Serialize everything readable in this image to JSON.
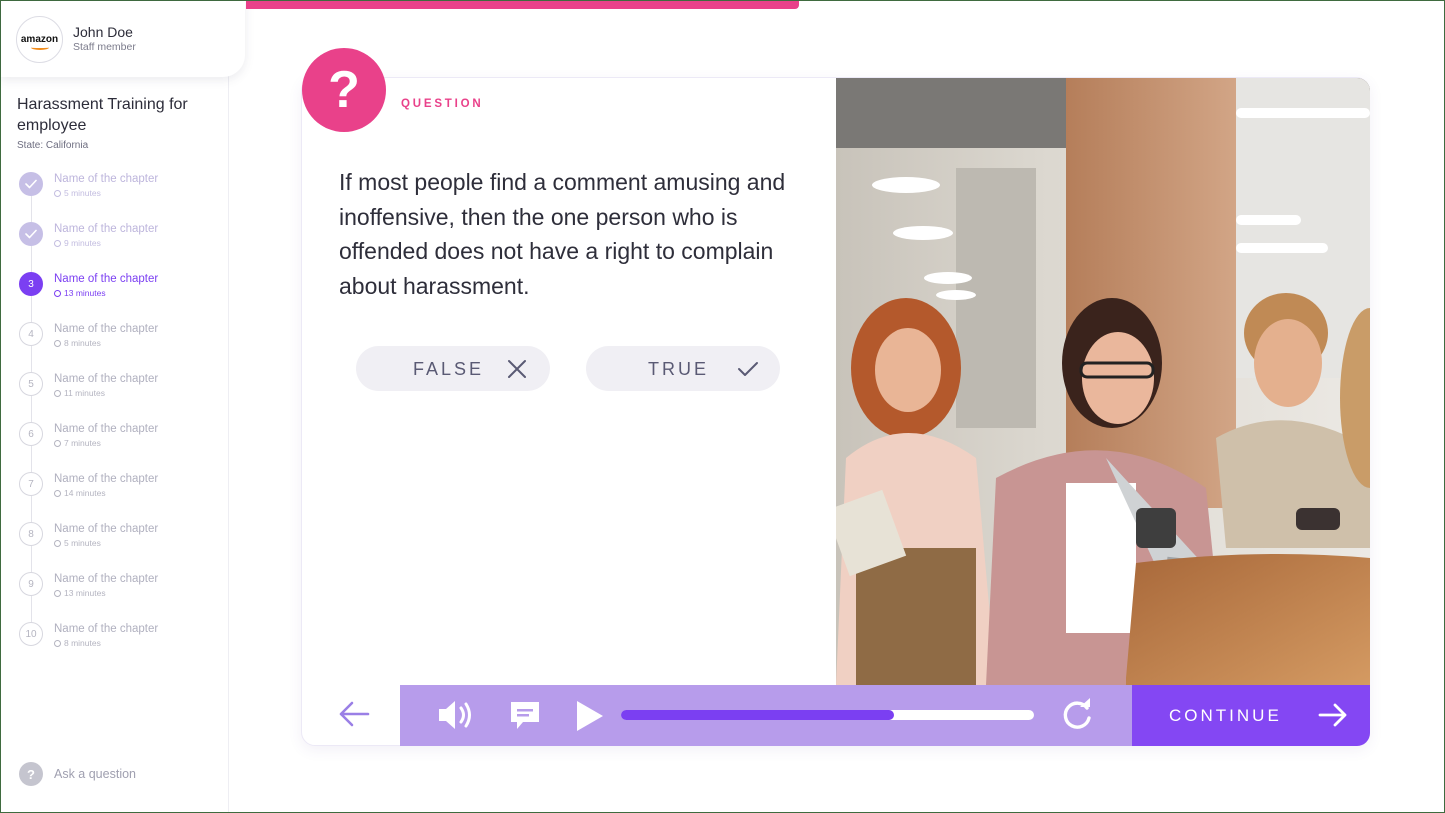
{
  "user": {
    "company_logo": "amazon",
    "name": "John Doe",
    "role": "Staff member"
  },
  "course": {
    "title": "Harassment Training for employee",
    "state": "State: California"
  },
  "chapters": [
    {
      "number": "1",
      "name": "Name of the chapter",
      "duration": "5 minutes",
      "status": "done"
    },
    {
      "number": "2",
      "name": "Name of the chapter",
      "duration": "9 minutes",
      "status": "done"
    },
    {
      "number": "3",
      "name": "Name of the chapter",
      "duration": "13 minutes",
      "status": "active"
    },
    {
      "number": "4",
      "name": "Name of the chapter",
      "duration": "8 minutes",
      "status": "upcoming"
    },
    {
      "number": "5",
      "name": "Name of the chapter",
      "duration": "11 minutes",
      "status": "upcoming"
    },
    {
      "number": "6",
      "name": "Name of the chapter",
      "duration": "7 minutes",
      "status": "upcoming"
    },
    {
      "number": "7",
      "name": "Name of the chapter",
      "duration": "14 minutes",
      "status": "upcoming"
    },
    {
      "number": "8",
      "name": "Name of the chapter",
      "duration": "5 minutes",
      "status": "upcoming"
    },
    {
      "number": "9",
      "name": "Name of the chapter",
      "duration": "13 minutes",
      "status": "upcoming"
    },
    {
      "number": "10",
      "name": "Name of the chapter",
      "duration": "8 minutes",
      "status": "upcoming"
    }
  ],
  "ask": {
    "label": "Ask a question",
    "icon": "question-circle-icon"
  },
  "progress": {
    "course_fraction": 0.38,
    "media_fraction": 0.66
  },
  "question": {
    "badge": "?",
    "label": "QUESTION",
    "text": "If most people find a comment amusing and inoffensive, then the one person who is offended does not have a right to complain about harassment.",
    "answers": [
      {
        "label": "FALSE",
        "icon": "x-icon"
      },
      {
        "label": "TRUE",
        "icon": "check-icon"
      }
    ]
  },
  "photo": {
    "subject": "people-working-at-laptop"
  },
  "controls": {
    "back_icon": "arrow-left-icon",
    "volume_icon": "speaker-icon",
    "captions_icon": "message-icon",
    "play_icon": "play-icon",
    "replay_icon": "refresh-icon",
    "continue_label": "CONTINUE",
    "continue_icon": "arrow-right-icon"
  },
  "colors": {
    "accent_pink": "#e9418a",
    "accent_purple": "#7b3ff2",
    "media_bar": "#b79ceb",
    "continue_bg": "#8447f3"
  }
}
